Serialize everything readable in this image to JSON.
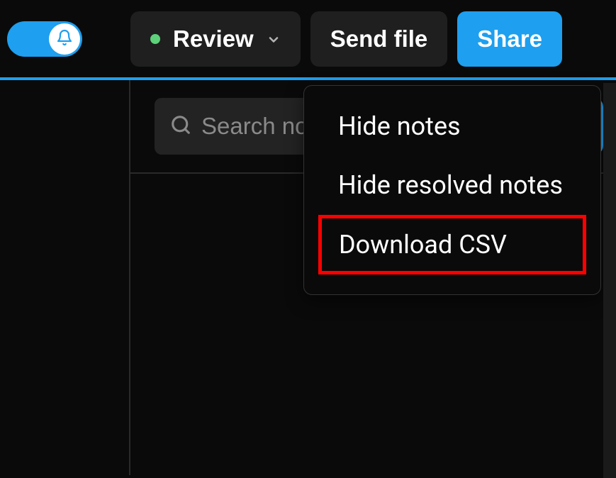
{
  "toolbar": {
    "review_label": "Review",
    "sendfile_label": "Send file",
    "share_label": "Share"
  },
  "search": {
    "placeholder": "Search notes"
  },
  "menu": {
    "hide_notes": "Hide notes",
    "hide_resolved": "Hide resolved notes",
    "download_csv": "Download CSV"
  },
  "colors": {
    "accent": "#1e9fef",
    "status_dot": "#5dd27a",
    "highlight_border": "#ff0000"
  }
}
